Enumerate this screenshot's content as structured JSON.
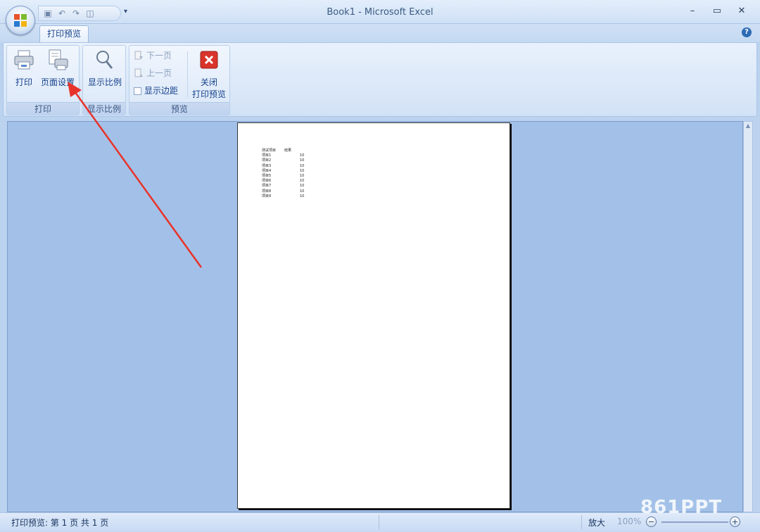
{
  "window": {
    "title": "Book1 - Microsoft Excel",
    "controls": {
      "minimize": "–",
      "maximize": "▭",
      "close": "✕"
    }
  },
  "quick_access": {
    "more": "▾"
  },
  "tabs": [
    {
      "label": "打印预览"
    }
  ],
  "ribbon": {
    "groups": {
      "print": {
        "label": "打印",
        "buttons": {
          "print": "打印",
          "page_setup": "页面设置"
        }
      },
      "zoom": {
        "label": "显示比例",
        "buttons": {
          "zoom": "显示比例"
        }
      },
      "preview": {
        "label": "预览",
        "buttons": {
          "next_page": "下一页",
          "prev_page": "上一页",
          "show_margins": "显示边距",
          "close_line1": "关闭",
          "close_line2": "打印预览"
        }
      }
    }
  },
  "sheet": {
    "headers": [
      "测试项目",
      "结果"
    ],
    "rows": [
      [
        "项目1",
        "10"
      ],
      [
        "项目2",
        "10"
      ],
      [
        "项目3",
        "10"
      ],
      [
        "项目4",
        "10"
      ],
      [
        "项目5",
        "10"
      ],
      [
        "项目6",
        "10"
      ],
      [
        "项目7",
        "10"
      ],
      [
        "项目8",
        "10"
      ],
      [
        "项目9",
        "10"
      ]
    ]
  },
  "status": {
    "text": "打印预览: 第 1 页  共 1 页",
    "zoom_label": "放大",
    "zoom_value": "100%",
    "zoom_out": "−",
    "zoom_in": "+"
  },
  "watermark": "861PPT",
  "colors": {
    "accent_arrow": "#e8332a",
    "ribbon_text": "#15428b"
  }
}
